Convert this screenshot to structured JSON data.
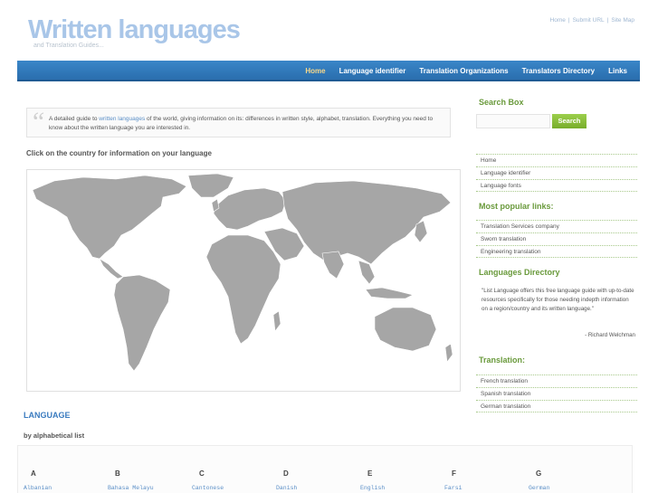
{
  "header": {
    "logo_title": "Written languages",
    "logo_subtitle": "and Translation Guides...",
    "top_links": [
      "Home",
      "Submit URL",
      "Site Map"
    ],
    "top_link_separator": "|"
  },
  "nav": {
    "items": [
      {
        "label": "Home",
        "active": true
      },
      {
        "label": "Language identifier",
        "active": false
      },
      {
        "label": "Translation Organizations",
        "active": false
      },
      {
        "label": "Translators Directory",
        "active": false
      },
      {
        "label": "Links",
        "active": false
      }
    ]
  },
  "intro": {
    "quote_glyph": "“",
    "text_before": "A detailed guide to ",
    "highlight": "written languages",
    "text_after": " of the world, giving information on its: differences in written style, alphabet, translation. Everything you need to know about the written language you are interested in."
  },
  "map": {
    "caption": "Click on the country for information on your language"
  },
  "language": {
    "heading": "LANGUAGE",
    "subheading": "by alphabetical list",
    "columns": [
      {
        "letter": "A",
        "first": "Albanian"
      },
      {
        "letter": "B",
        "first": "Bahasa Melayu"
      },
      {
        "letter": "C",
        "first": "Cantonese"
      },
      {
        "letter": "D",
        "first": "Danish"
      },
      {
        "letter": "E",
        "first": "English"
      },
      {
        "letter": "F",
        "first": "Farsi"
      },
      {
        "letter": "G",
        "first": "German"
      }
    ]
  },
  "sidebar": {
    "search_heading": "Search Box",
    "search_placeholder": "",
    "search_button": "Search",
    "main_links": [
      "Home",
      "Language identifier",
      "Language fonts"
    ],
    "popular_heading": "Most popular links:",
    "popular_links": [
      "Translation Services company",
      "Sworn translation",
      "Engineering translation"
    ],
    "directory_heading": "Languages Directory",
    "directory_quote": "\"List Language offers this free language guide with up-to-date resources specifically for those needing indepth information on a region/country and its written language.\"",
    "directory_author": "- Richard Welchman",
    "translation_heading": "Translation:",
    "translation_links": [
      "French translation",
      "Spanish translation",
      "German translation"
    ]
  },
  "colors": {
    "nav_blue": "#2a6eae",
    "nav_active": "#f7d88a",
    "sidebar_green": "#6a9a3c",
    "search_button": "#86bd36",
    "link_blue": "#5b8fc7",
    "map_land": "#a6a6a6"
  }
}
